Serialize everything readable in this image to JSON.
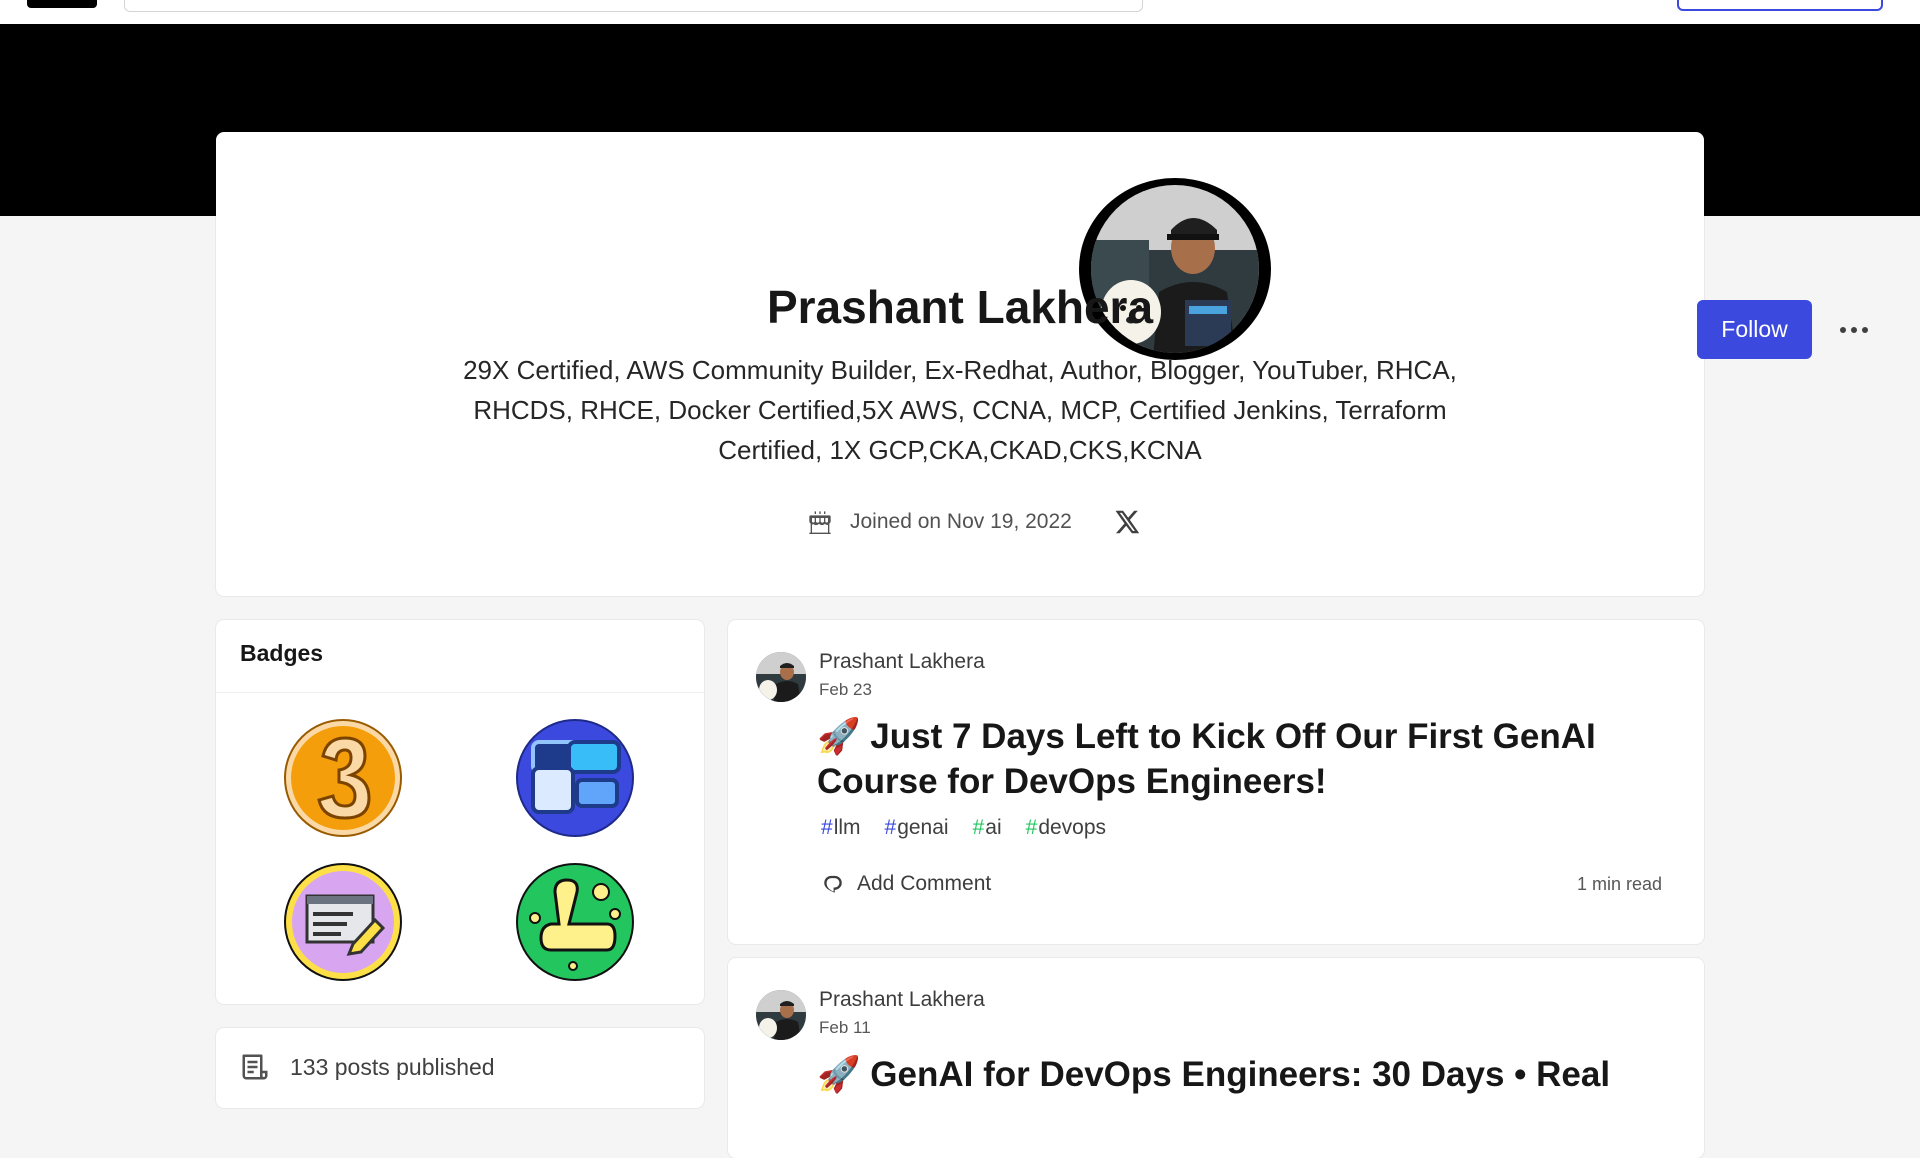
{
  "profile": {
    "name": "Prashant Lakhera",
    "bio": "29X Certified, AWS Community Builder, Ex-Redhat, Author, Blogger, YouTuber, RHCA, RHCDS, RHCE, Docker Certified,5X AWS, CCNA, MCP, Certified Jenkins, Terraform Certified, 1X GCP,CKA,CKAD,CKS,KCNA",
    "joined": "Joined on Nov 19, 2022",
    "follow_label": "Follow"
  },
  "icons": {
    "more": "more-horizontal-icon",
    "cake": "cake-icon",
    "x": "x-twitter-icon",
    "comment": "comment-icon",
    "posts": "post-icon"
  },
  "colors": {
    "accent": "#3b49df",
    "banner": "#000000"
  },
  "badges": {
    "title": "Badges",
    "items": [
      {
        "icon": "three-year-badge-icon"
      },
      {
        "icon": "puzzle-blocks-badge-icon"
      },
      {
        "icon": "writing-badge-icon"
      },
      {
        "icon": "one-year-badge-icon"
      }
    ]
  },
  "stats": {
    "posts_published": "133 posts published"
  },
  "articles": [
    {
      "author": "Prashant Lakhera",
      "date": "Feb 23",
      "title": "🚀 Just 7 Days Left to Kick Off Our First GenAI Course for DevOps Engineers!",
      "tags": [
        {
          "name": "llm",
          "color": "#3b49df"
        },
        {
          "name": "genai",
          "color": "#3b49df"
        },
        {
          "name": "ai",
          "color": "#22c55e"
        },
        {
          "name": "devops",
          "color": "#22c55e"
        }
      ],
      "comment_label": "Add Comment",
      "read_time": "1 min read"
    },
    {
      "author": "Prashant Lakhera",
      "date": "Feb 11",
      "title": "🚀 GenAI for DevOps Engineers: 30 Days • Real"
    }
  ]
}
